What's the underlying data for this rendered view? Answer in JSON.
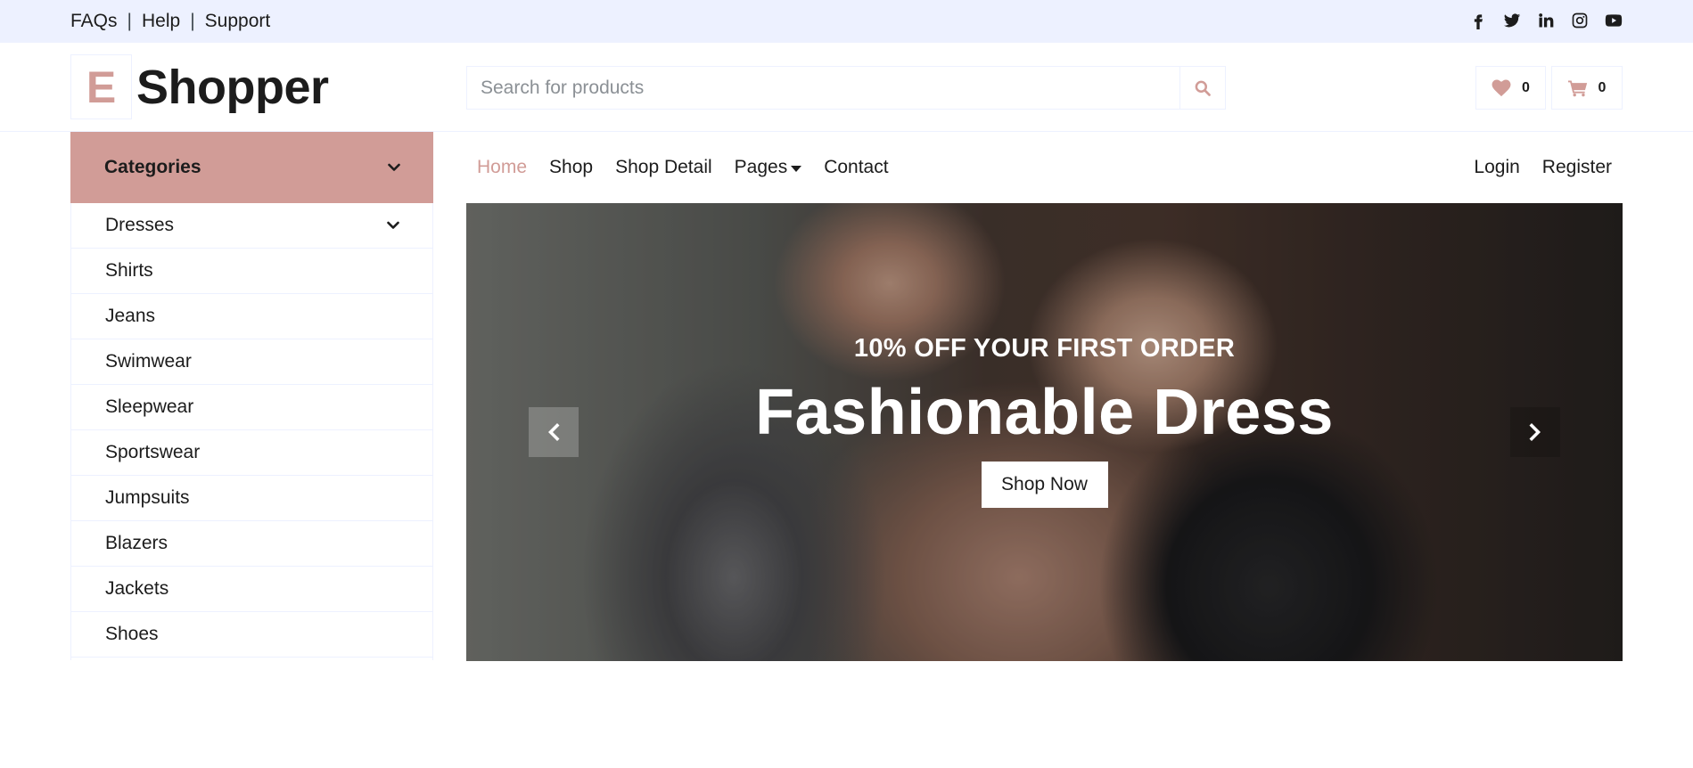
{
  "topbar": {
    "links": [
      "FAQs",
      "Help",
      "Support"
    ],
    "separator": "|",
    "social_icons": [
      "facebook-icon",
      "twitter-icon",
      "linkedin-icon",
      "instagram-icon",
      "youtube-icon"
    ]
  },
  "header": {
    "logo_letter": "E",
    "logo_text": "Shopper",
    "search_placeholder": "Search for products",
    "wishlist_count": "0",
    "cart_count": "0"
  },
  "categories": {
    "title": "Categories",
    "items": [
      "Dresses",
      "Shirts",
      "Jeans",
      "Swimwear",
      "Sleepwear",
      "Sportswear",
      "Jumpsuits",
      "Blazers",
      "Jackets",
      "Shoes"
    ]
  },
  "nav": {
    "items": [
      "Home",
      "Shop",
      "Shop Detail",
      "Pages",
      "Contact"
    ],
    "active": "Home",
    "right": [
      "Login",
      "Register"
    ]
  },
  "hero": {
    "subtitle": "10% OFF YOUR FIRST ORDER",
    "title": "Fashionable Dress",
    "button": "Shop Now"
  },
  "colors": {
    "accent": "#d19c97",
    "topbar_bg": "#edf1ff",
    "text": "#1c1c1c"
  }
}
